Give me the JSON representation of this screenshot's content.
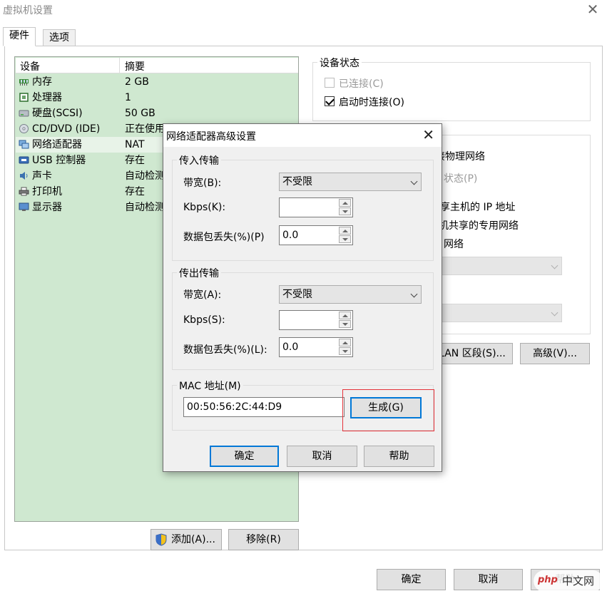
{
  "window": {
    "title": "虚拟机设置",
    "close_glyph": "✕"
  },
  "tabs": [
    {
      "label": "硬件",
      "active": true
    },
    {
      "label": "选项",
      "active": false
    }
  ],
  "device_list": {
    "col_device": "设备",
    "col_summary": "摘要",
    "rows": [
      {
        "icon": "memory-icon",
        "name": "内存",
        "summary": "2 GB"
      },
      {
        "icon": "processor-icon",
        "name": "处理器",
        "summary": "1"
      },
      {
        "icon": "hard-disk-icon",
        "name": "硬盘(SCSI)",
        "summary": "50 GB"
      },
      {
        "icon": "cd-dvd-icon",
        "name": "CD/DVD (IDE)",
        "summary": "正在使用"
      },
      {
        "icon": "network-adapter-icon",
        "name": "网络适配器",
        "summary": "NAT",
        "selected": true
      },
      {
        "icon": "usb-icon",
        "name": "USB 控制器",
        "summary": "存在"
      },
      {
        "icon": "sound-card-icon",
        "name": "声卡",
        "summary": "自动检测"
      },
      {
        "icon": "printer-icon",
        "name": "打印机",
        "summary": "存在"
      },
      {
        "icon": "display-icon",
        "name": "显示器",
        "summary": "自动检测"
      }
    ],
    "add_label": "添加(A)...",
    "remove_label": "移除(R)"
  },
  "device_status": {
    "legend": "设备状态",
    "connected_label": "已连接(C)",
    "connected_checked": false,
    "connect_on_start_label": "启动时连接(O)",
    "connect_on_start_checked": true
  },
  "network_conn": {
    "physical_partial": "接物理网络",
    "state_partial": "状态(P)",
    "nat_partial": "享主机的 IP 地址",
    "hostonly_partial": "机共享的专用网络",
    "custom_partial": "网络",
    "lan_segments_label": "LAN 区段(S)...",
    "advanced_label": "高级(V)..."
  },
  "main_buttons": {
    "ok": "确定",
    "cancel": "取消",
    "help": "帮助"
  },
  "advanced_dialog": {
    "title": "网络适配器高级设置",
    "close_glyph": "✕",
    "incoming": {
      "legend": "传入传输",
      "bandwidth_label": "带宽(B):",
      "bandwidth_value": "不受限",
      "kbps_label": "Kbps(K):",
      "kbps_value": "",
      "loss_label": "数据包丢失(%)(P)",
      "loss_value": "0.0"
    },
    "outgoing": {
      "legend": "传出传输",
      "bandwidth_label": "带宽(A):",
      "bandwidth_value": "不受限",
      "kbps_label": "Kbps(S):",
      "kbps_value": "",
      "loss_label": "数据包丢失(%)(L):",
      "loss_value": "0.0"
    },
    "mac": {
      "legend": "MAC 地址(M)",
      "value": "00:50:56:2C:44:D9",
      "generate_label": "生成(G)"
    },
    "ok": "确定",
    "cancel": "取消",
    "help": "帮助"
  },
  "watermark": {
    "php": "php",
    "cn": "中文网"
  },
  "colors": {
    "list_bg": "#cfe8d0",
    "dialog_bg": "#f0f0f0",
    "focus_border": "#0078d7",
    "highlight": "#e5333a"
  }
}
